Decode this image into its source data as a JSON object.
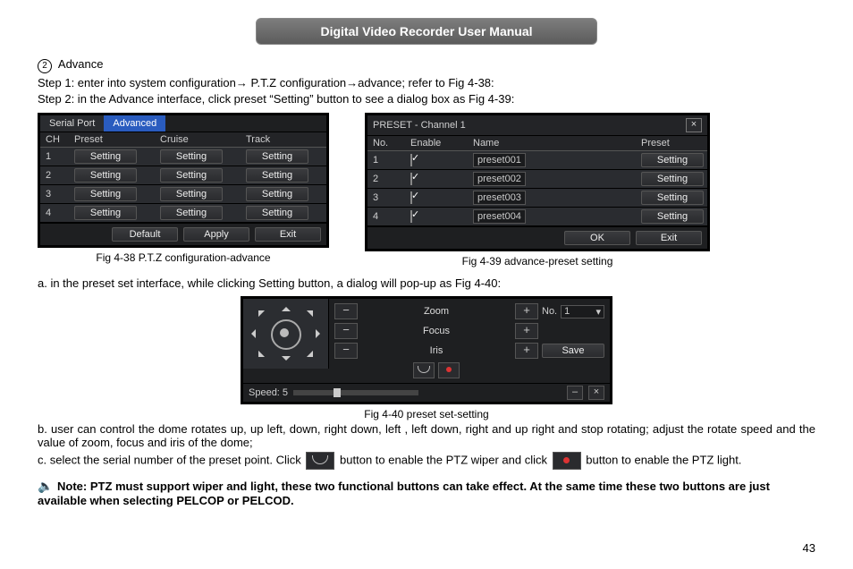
{
  "title": "Digital Video Recorder User Manual",
  "section_num": "2",
  "section_label": "Advance",
  "step1": "Step 1: enter into system configuration→ P.T.Z configuration→advance; refer to Fig 4-38:",
  "step2": "Step 2: in the Advance interface, click preset “Setting” button to see a dialog box as Fig 4-39:",
  "fig438": {
    "tabs": {
      "serial": "Serial Port",
      "advanced": "Advanced"
    },
    "headers": {
      "ch": "CH",
      "preset": "Preset",
      "cruise": "Cruise",
      "track": "Track"
    },
    "rows": [
      {
        "ch": "1",
        "preset": "Setting",
        "cruise": "Setting",
        "track": "Setting"
      },
      {
        "ch": "2",
        "preset": "Setting",
        "cruise": "Setting",
        "track": "Setting"
      },
      {
        "ch": "3",
        "preset": "Setting",
        "cruise": "Setting",
        "track": "Setting"
      },
      {
        "ch": "4",
        "preset": "Setting",
        "cruise": "Setting",
        "track": "Setting"
      }
    ],
    "footer": {
      "default": "Default",
      "apply": "Apply",
      "exit": "Exit"
    },
    "caption": "Fig 4-38 P.T.Z configuration-advance"
  },
  "fig439": {
    "title": "PRESET - Channel 1",
    "headers": {
      "no": "No.",
      "enable": "Enable",
      "name": "Name",
      "preset": "Preset"
    },
    "rows": [
      {
        "no": "1",
        "name": "preset001",
        "btn": "Setting"
      },
      {
        "no": "2",
        "name": "preset002",
        "btn": "Setting"
      },
      {
        "no": "3",
        "name": "preset003",
        "btn": "Setting"
      },
      {
        "no": "4",
        "name": "preset004",
        "btn": "Setting"
      }
    ],
    "footer": {
      "ok": "OK",
      "exit": "Exit"
    },
    "caption": "Fig 4-39 advance-preset setting"
  },
  "para_a": "a. in the preset set interface, while clicking Setting button, a dialog will pop-up as Fig 4-40:",
  "fig440": {
    "zoom": "Zoom",
    "focus": "Focus",
    "iris": "Iris",
    "minus": "−",
    "plus": "+",
    "no_label": "No.",
    "no_value": "1",
    "save": "Save",
    "speed_label": "Speed: 5",
    "caption": "Fig 4-40 preset set-setting"
  },
  "para_b": "b. user can control the dome rotates up, up left, down, right down, left , left down, right and up right and stop rotating; adjust the rotate speed and the value of zoom, focus and iris of the dome;",
  "para_c_1": "c. select the serial number of the preset point. Click ",
  "para_c_2": " button to enable the PTZ wiper and click ",
  "para_c_3": " button to enable the PTZ light.",
  "note": "Note: PTZ must support wiper and light, these two functional buttons can take effect. At the same time these two buttons are just available when selecting PELCOP or PELCOD.",
  "page_number": "43"
}
